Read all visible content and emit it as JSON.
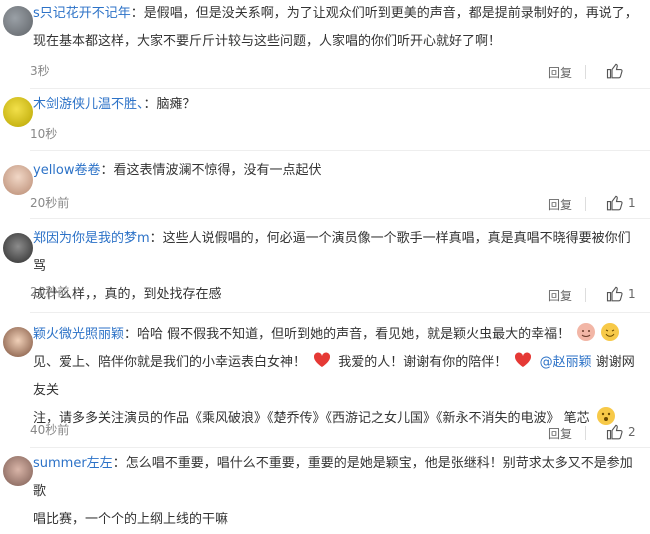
{
  "comments": [
    {
      "user": "s只记花开不记年",
      "text_line1": "：是假唱，但是没关系啊，为了让观众们听到更美的声音，都是提前录制好的，再说了，",
      "text_line2": "现在基本都这样，大家不要斤斤计较与这些问题，人家唱的你们听开心就好了啊！",
      "time": "3秒",
      "reply": "回复",
      "likes": ""
    },
    {
      "user": "木剑游侠儿温不胜、",
      "text_line1": "：脑瘫？",
      "time": "10秒",
      "reply": "回复",
      "likes": ""
    },
    {
      "user": "yellow卷卷",
      "text_line1": "：看这表情波澜不惊得，没有一点起伏",
      "time": "20秒前",
      "reply": "回复",
      "likes": "1"
    },
    {
      "user": "郑因为你是我的梦m",
      "text_line1": "：这些人说假唱的，何必逼一个演员像一个歌手一样真唱，真是真唱不晓得要被你们骂",
      "text_line2": "成什么样，，真的，到处找存在感",
      "time": "20秒前",
      "reply": "回复",
      "likes": "1"
    },
    {
      "user": "颖火微光照丽颖",
      "text_line1a": "：哈哈 假不假我不知道，但听到她的声音，看见她，就是颖火虫最大的幸福！",
      "text_line2a": "见、爱上、陪伴你就是我们的小幸运表白女神！",
      "text_line2b": "我爱的人！谢谢有你的陪伴！",
      "mention": "@赵丽颖",
      "text_line2c": " 谢谢网友关",
      "text_line3a": "注，请多多关注演员的作品《乘风破浪》《楚乔传》《西游记之女儿国》《新永不消失的电波》 笔芯",
      "time": "40秒前",
      "reply": "回复",
      "likes": "2"
    },
    {
      "user": "summer左左",
      "text_line1": "：怎么唱不重要，唱什么不重要，重要的是她是颖宝，他是张继科！别苛求太多又不是参加歌",
      "text_line2": "唱比赛，一个个的上纲上线的干嘛"
    }
  ]
}
